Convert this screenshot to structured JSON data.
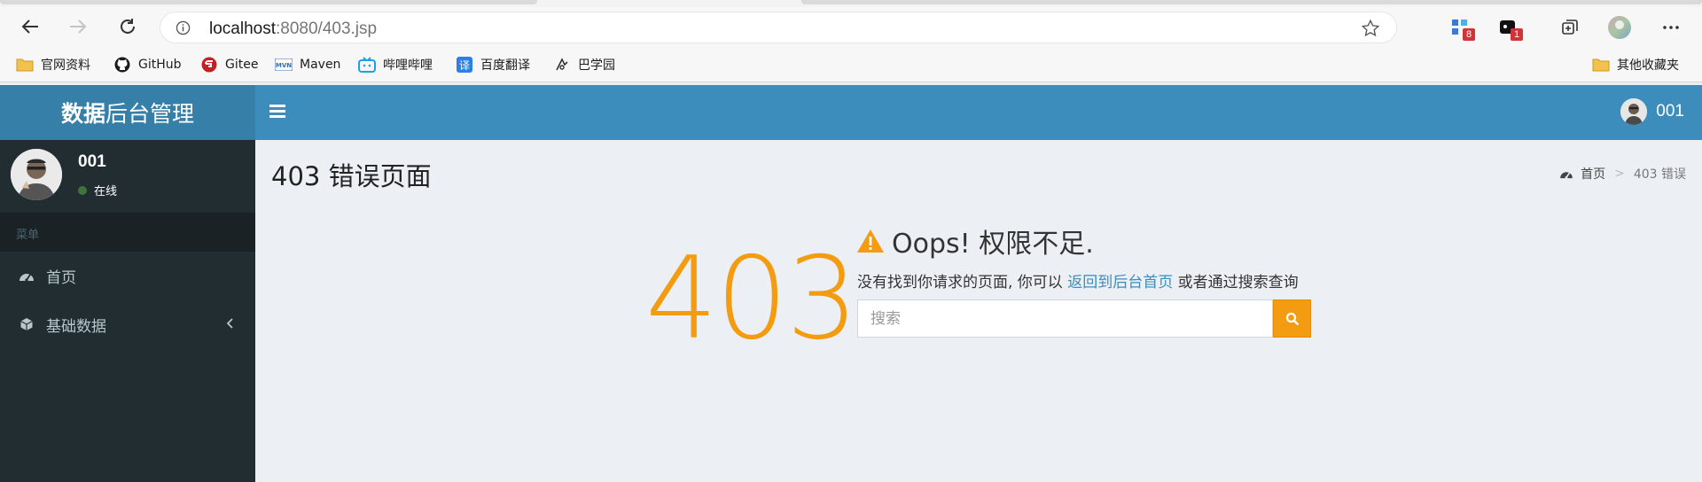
{
  "browser": {
    "url_host": "localhost",
    "url_rest": ":8080/403.jsp",
    "extensions": [
      {
        "name": "extension-1",
        "badge": "8"
      },
      {
        "name": "extension-2",
        "badge": "1"
      }
    ],
    "bookmarks": [
      {
        "label": "官网资料",
        "icon": "folder-icon"
      },
      {
        "label": "GitHub",
        "icon": "github-icon"
      },
      {
        "label": "Gitee",
        "icon": "gitee-icon"
      },
      {
        "label": "Maven",
        "icon": "maven-icon"
      },
      {
        "label": "哔哩哔哩",
        "icon": "bilibili-icon"
      },
      {
        "label": "百度翻译",
        "icon": "translate-icon"
      },
      {
        "label": "巴学园",
        "icon": "bxy-icon"
      }
    ],
    "other_bookmarks": "其他收藏夹"
  },
  "app": {
    "logo_bold": "数据",
    "logo_rest": "后台管理",
    "nav_user": "001",
    "sidebar": {
      "user_name": "001",
      "user_status": "在线",
      "menu_header": "菜单",
      "items": [
        {
          "label": "首页",
          "icon": "dashboard-icon"
        },
        {
          "label": "基础数据",
          "icon": "cube-icon"
        }
      ]
    },
    "content": {
      "page_title": "403 错误页面",
      "breadcrumb": {
        "home": "首页",
        "sep": ">",
        "current": "403 错误"
      },
      "error_code": "403",
      "error_title": "Oops! 权限不足.",
      "message_prefix": "没有找到你请求的页面, 你可以 ",
      "message_link": "返回到后台首页",
      "message_suffix": " 或者通过搜索查询",
      "search_placeholder": "搜索"
    }
  },
  "colors": {
    "navbar": "#3c8dbc",
    "logo_bg": "#367fa9",
    "sidebar_bg": "#222d32",
    "warning": "#f39c12",
    "content_bg": "#ecf0f5"
  }
}
